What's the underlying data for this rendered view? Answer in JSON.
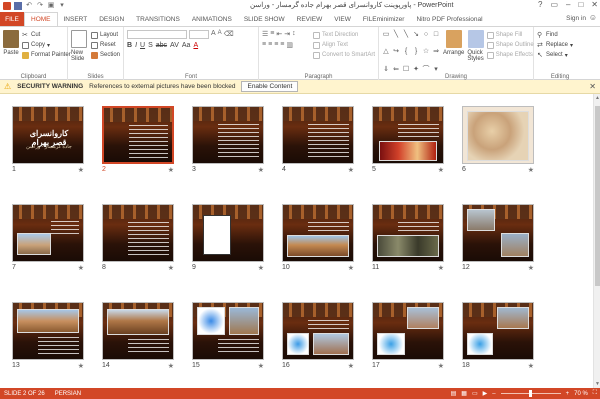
{
  "app": {
    "title": "پاورپوینت کاروانسرای قصر بهرام جاده گرمسار - وراسن - PowerPoint"
  },
  "tabs": [
    "FILE",
    "HOME",
    "INSERT",
    "DESIGN",
    "TRANSITIONS",
    "ANIMATIONS",
    "SLIDE SHOW",
    "REVIEW",
    "VIEW",
    "FILEminimizer",
    "Nitro PDF Professional"
  ],
  "signin": "Sign in",
  "ribbon": {
    "clipboard": {
      "paste": "Paste",
      "cut": "Cut",
      "copy": "Copy",
      "format_painter": "Format Painter",
      "label": "Clipboard"
    },
    "slides": {
      "new_slide": "New Slide",
      "layout": "Layout",
      "reset": "Reset",
      "section": "Section",
      "label": "Slides"
    },
    "font": {
      "label": "Font"
    },
    "paragraph": {
      "text_direction": "Text Direction",
      "align_text": "Align Text",
      "convert": "Convert to SmartArt",
      "label": "Paragraph"
    },
    "drawing": {
      "arrange": "Arrange",
      "quick_styles": "Quick Styles",
      "shape_fill": "Shape Fill",
      "shape_outline": "Shape Outline",
      "shape_effects": "Shape Effects",
      "label": "Drawing"
    },
    "editing": {
      "find": "Find",
      "replace": "Replace",
      "select": "Select",
      "label": "Editing"
    }
  },
  "security": {
    "title": "SECURITY WARNING",
    "message": "References to external pictures have been blocked",
    "button": "Enable Content"
  },
  "slides": [
    {
      "num": "1",
      "title": "کاروانسرای قصر بهرام",
      "subtitle": "جاده گرمسار - وراسن"
    },
    {
      "num": "2"
    },
    {
      "num": "3"
    },
    {
      "num": "4"
    },
    {
      "num": "5"
    },
    {
      "num": "6"
    },
    {
      "num": "7"
    },
    {
      "num": "8"
    },
    {
      "num": "9"
    },
    {
      "num": "10"
    },
    {
      "num": "11"
    },
    {
      "num": "12"
    },
    {
      "num": "13"
    },
    {
      "num": "14"
    },
    {
      "num": "15"
    },
    {
      "num": "16"
    },
    {
      "num": "17"
    },
    {
      "num": "18"
    }
  ],
  "selected_slide": 2,
  "status": {
    "slide": "SLIDE 2 OF 26",
    "language": "PERSIAN",
    "zoom": "70 %"
  },
  "colors": {
    "accent": "#d24726",
    "warning_bg": "#fff4ce"
  }
}
